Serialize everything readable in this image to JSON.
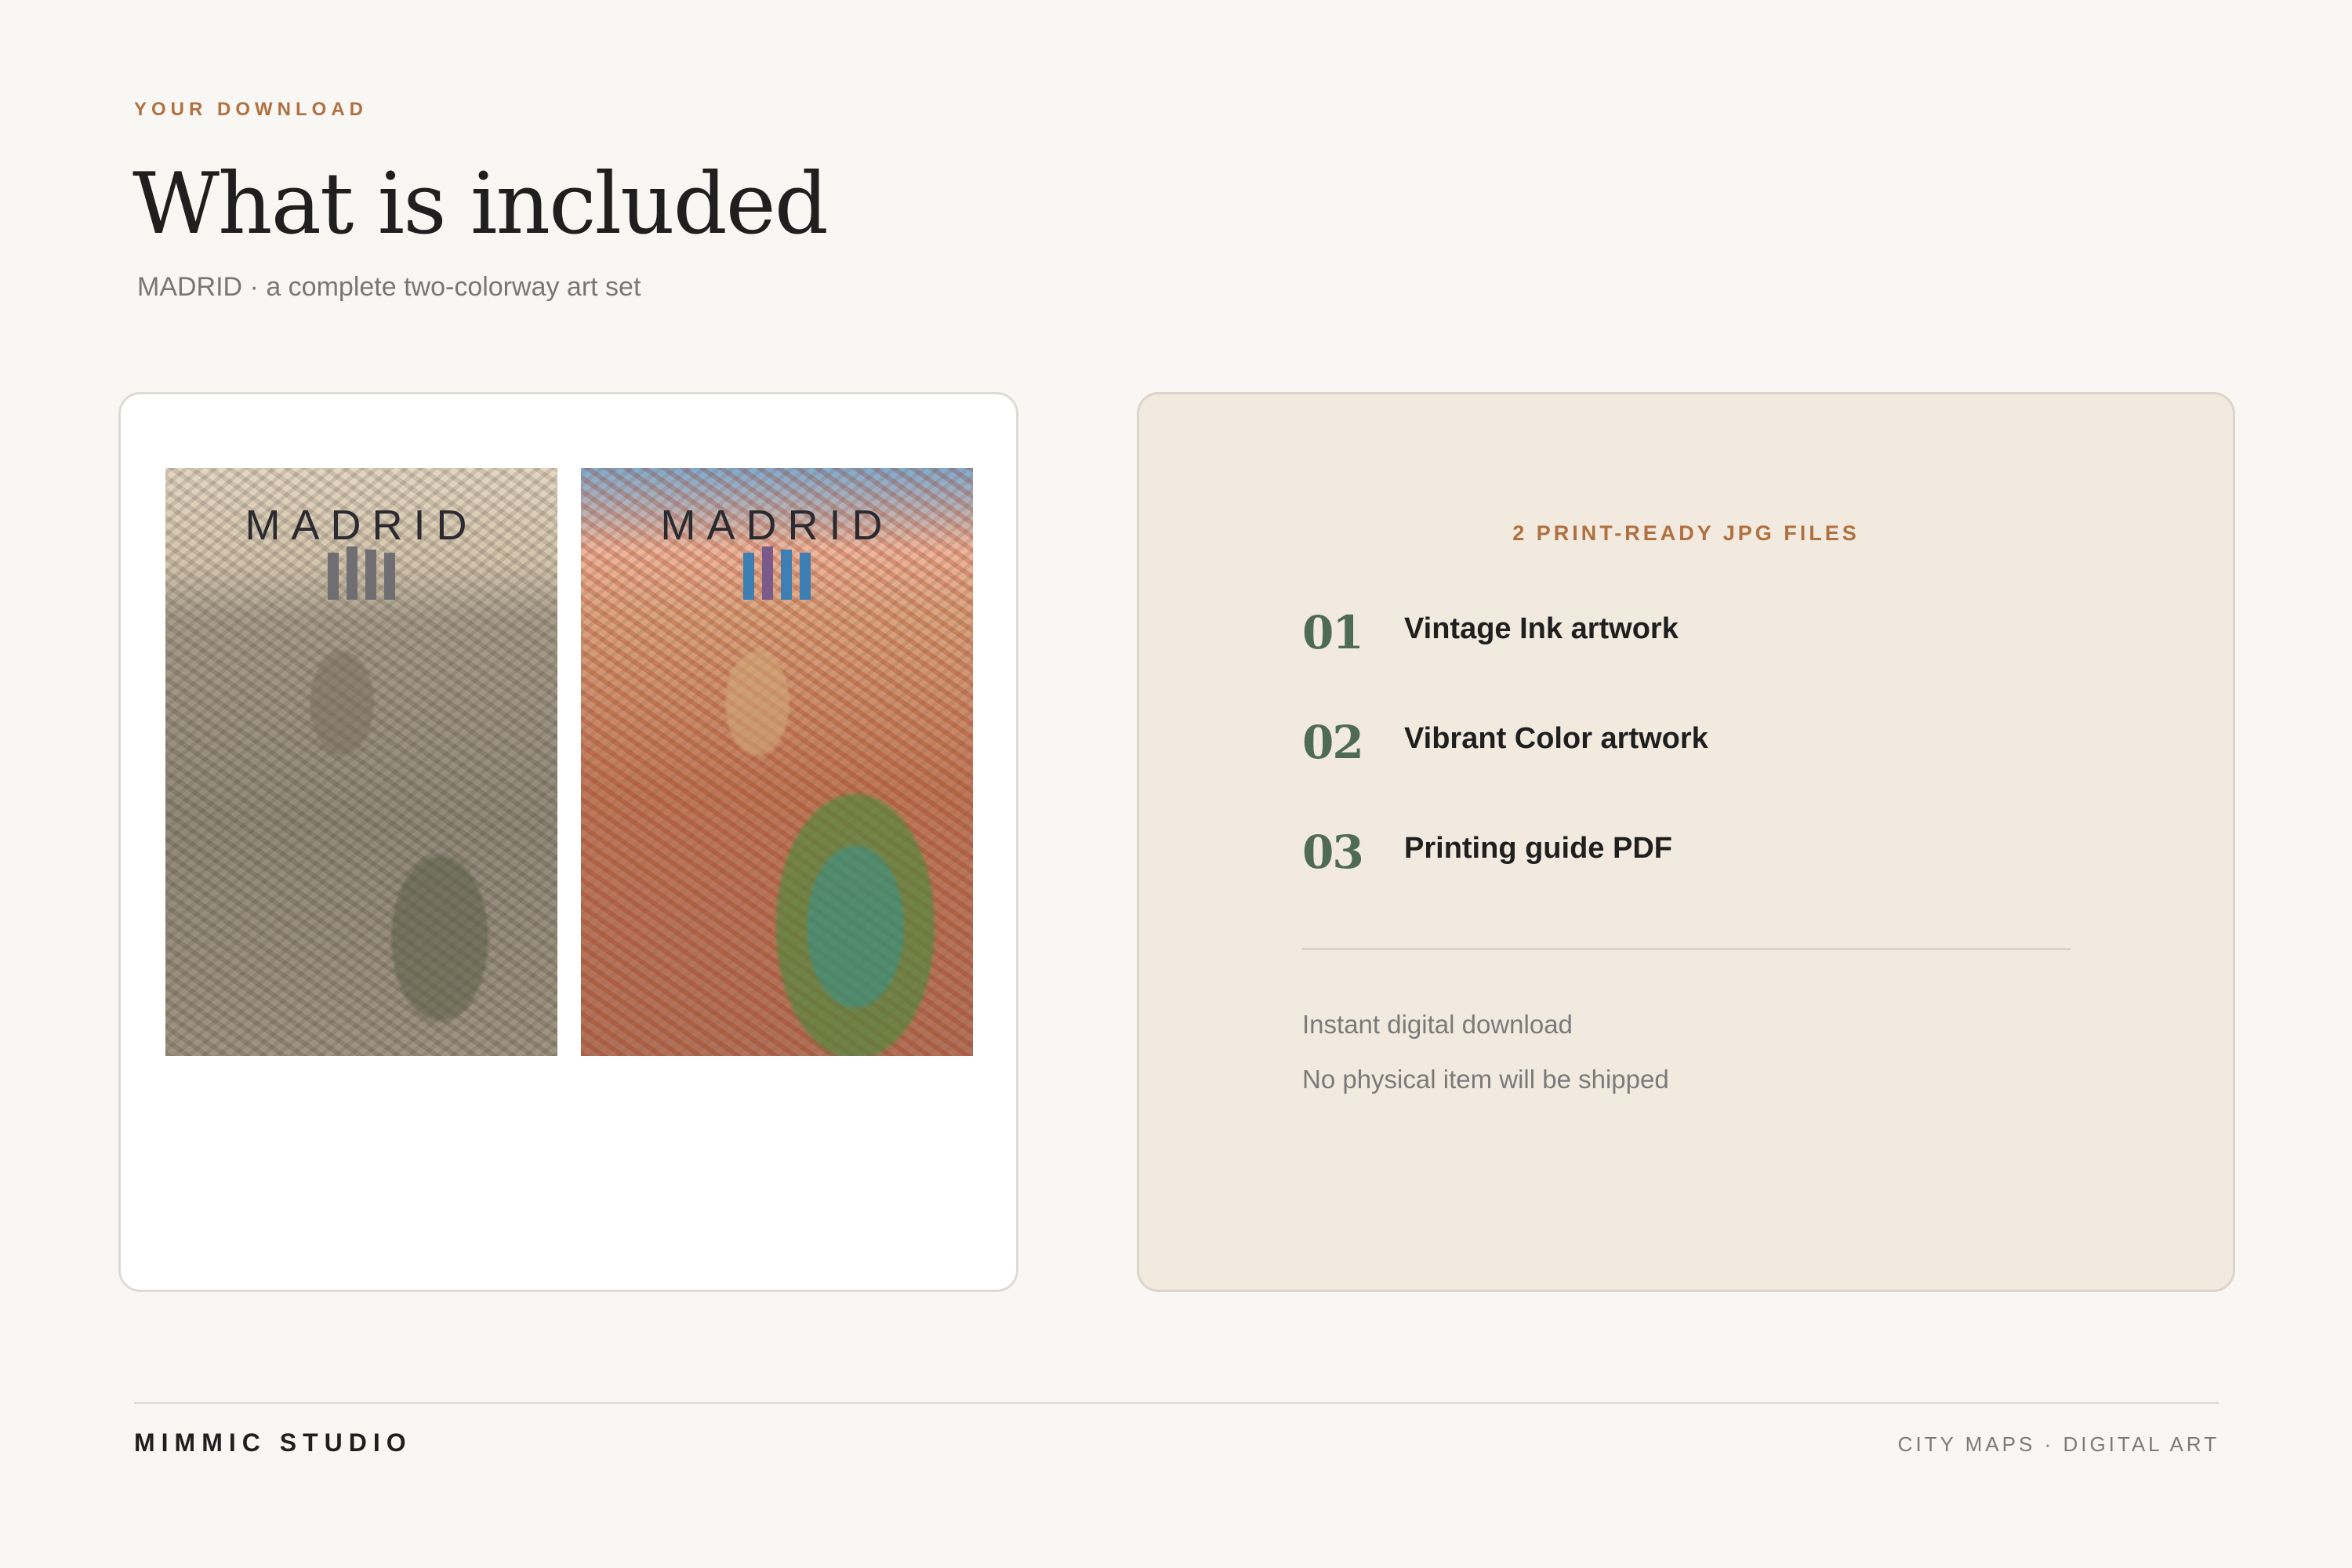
{
  "header": {
    "eyebrow": "YOUR DOWNLOAD",
    "title": "What is included",
    "subtitle": "MADRID · a complete two-colorway art set"
  },
  "preview": {
    "posters": [
      {
        "city": "MADRID",
        "style": "ink"
      },
      {
        "city": "MADRID",
        "style": "color"
      }
    ]
  },
  "details": {
    "files_label": "2 PRINT-READY JPG FILES",
    "items": [
      {
        "num": "01",
        "label": "Vintage Ink artwork"
      },
      {
        "num": "02",
        "label": "Vibrant Color artwork"
      },
      {
        "num": "03",
        "label": "Printing guide PDF"
      }
    ],
    "notes": [
      "Instant digital download",
      "No physical item will be shipped"
    ]
  },
  "footer": {
    "brand": "MIMMIC STUDIO",
    "tagline": "CITY MAPS · DIGITAL ART"
  },
  "colors": {
    "accent": "#b07040",
    "number": "#4f6b55",
    "panel": "#f2eadf"
  }
}
